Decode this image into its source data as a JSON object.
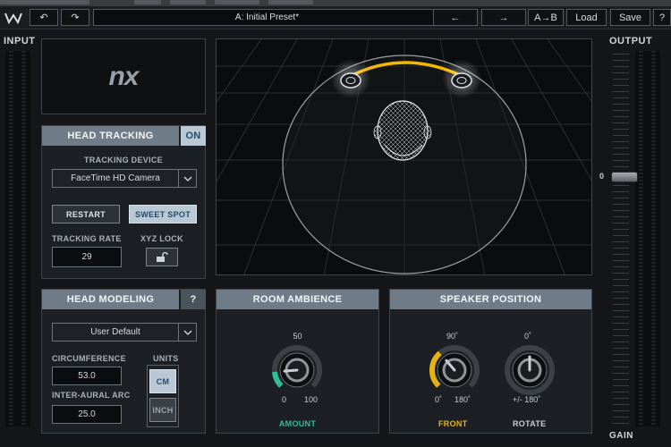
{
  "topbar": {
    "undo_label": "↶",
    "redo_label": "↷",
    "preset_name": "A: Initial Preset*",
    "prev_label": "←",
    "next_label": "→",
    "ab_label": "A→B",
    "load_label": "Load",
    "save_label": "Save",
    "help_label": "?"
  },
  "meters": {
    "input_label": "INPUT",
    "output_label": "OUTPUT",
    "gain_label": "GAIN",
    "gain_value": "0"
  },
  "logo": {
    "text": "nx"
  },
  "head_tracking": {
    "title": "HEAD TRACKING",
    "toggle": "ON",
    "device_label": "TRACKING DEVICE",
    "device_value": "FaceTime HD Camera",
    "restart_label": "RESTART",
    "sweet_spot_label": "SWEET SPOT",
    "rate_label": "TRACKING RATE",
    "rate_value": "29",
    "xyz_label": "XYZ LOCK"
  },
  "head_modeling": {
    "title": "HEAD MODELING",
    "help": "?",
    "model_value": "User Default",
    "circ_label": "CIRCUMFERENCE",
    "circ_value": "53.0",
    "arc_label": "INTER-AURAL  ARC",
    "arc_value": "25.0",
    "units_label": "UNITS",
    "unit_cm": "CM",
    "unit_inch": "INCH"
  },
  "room_ambience": {
    "title": "ROOM AMBIENCE",
    "top_value": "50",
    "min_value": "0",
    "max_value": "100",
    "knob_label": "AMOUNT",
    "amount_fraction": 0.15,
    "color": "#2fbf94"
  },
  "speaker_position": {
    "title": "SPEAKER POSITION",
    "front_top": "90˚",
    "front_min": "0˚",
    "front_max": "180˚",
    "front_label": "FRONT",
    "front_fraction": 0.35,
    "front_color": "#e8b311",
    "rotate_top": "0˚",
    "rotate_range": "+/- 180˚",
    "rotate_label": "ROTATE"
  }
}
